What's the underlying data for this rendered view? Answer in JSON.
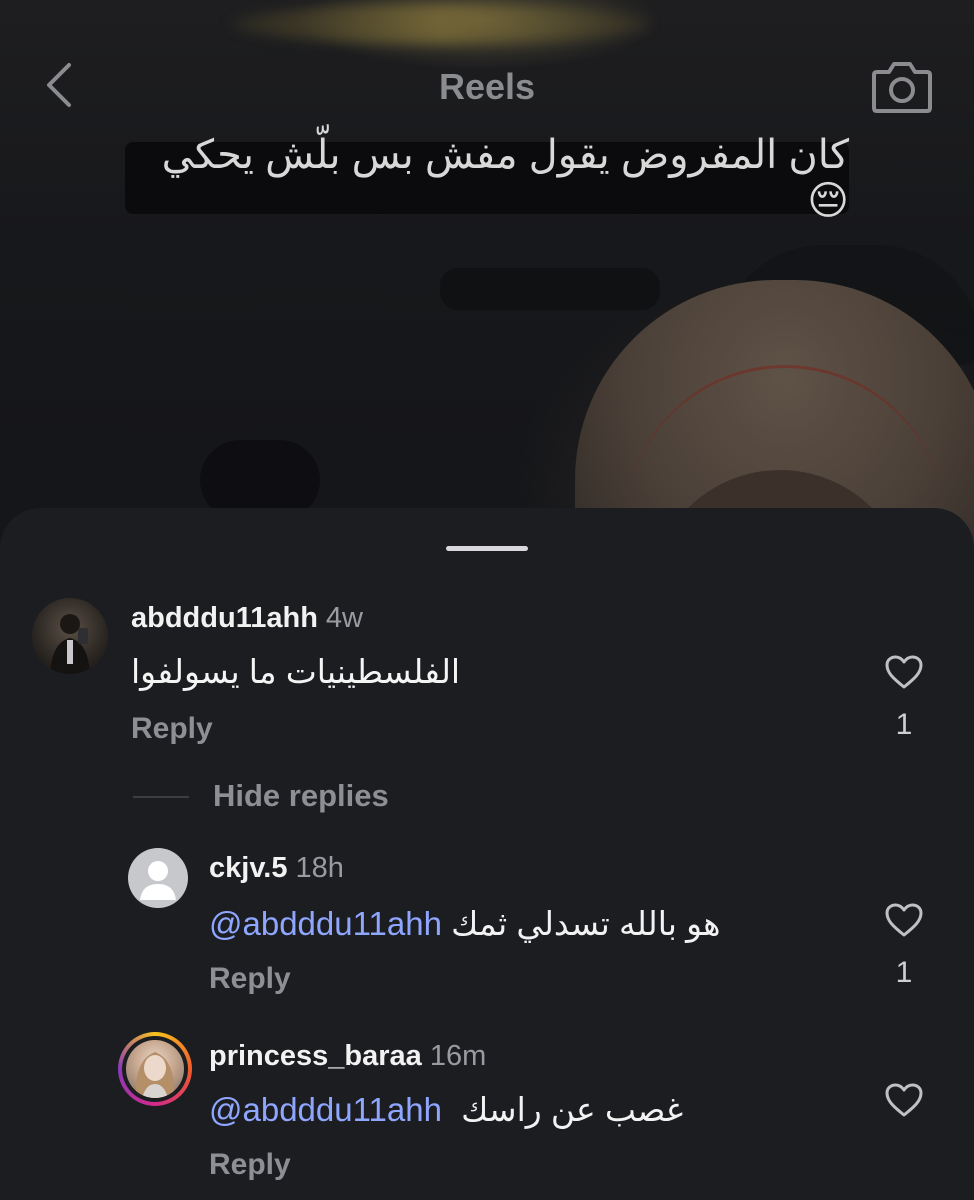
{
  "header": {
    "title": "Reels",
    "back_icon": "chevron-left-icon",
    "camera_icon": "camera-icon"
  },
  "video": {
    "caption": "كان المفروض يقول مفش بس بلّش يحكي 😔"
  },
  "colors": {
    "sheet_bg": "#1c1d21",
    "mention": "#8fa6ff",
    "muted": "#8e8f94"
  },
  "comments": [
    {
      "username": "abdddu11ahh",
      "time": "4w",
      "text": "الفلسطينيات ما يسولفوا",
      "reply_label": "Reply",
      "likes": "1"
    }
  ],
  "hide_replies_label": "Hide replies",
  "replies": [
    {
      "username": "ckjv.5",
      "time": "18h",
      "mention": "@abdddu11ahh",
      "text": "هو بالله تسدلي ثمك",
      "reply_label": "Reply",
      "likes": "1"
    },
    {
      "username": "princess_baraa",
      "time": "16m",
      "mention": "@abdddu11ahh",
      "text": "غصب عن راسك",
      "reply_label": "Reply"
    }
  ]
}
